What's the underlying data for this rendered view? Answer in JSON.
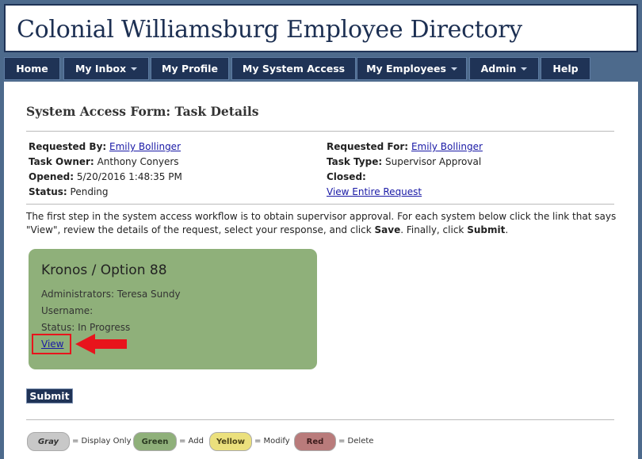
{
  "header": {
    "title": "Colonial Williamsburg Employee Directory"
  },
  "nav": [
    {
      "label": "Home",
      "has_dropdown": false
    },
    {
      "label": "My Inbox",
      "has_dropdown": true
    },
    {
      "label": "My Profile",
      "has_dropdown": false
    },
    {
      "label": "My System Access",
      "has_dropdown": false
    },
    {
      "label": "My Employees",
      "has_dropdown": true
    },
    {
      "label": "Admin",
      "has_dropdown": true
    },
    {
      "label": "Help",
      "has_dropdown": false
    }
  ],
  "form": {
    "title": "System Access Form: Task Details",
    "requested_by_label": "Requested By:",
    "requested_by_value": "Emily Bollinger",
    "task_owner_label": "Task Owner:",
    "task_owner_value": "Anthony Conyers",
    "opened_label": "Opened:",
    "opened_value": "5/20/2016 1:48:35 PM",
    "status_label": "Status:",
    "status_value": "Pending",
    "requested_for_label": "Requested For:",
    "requested_for_value": "Emily Bollinger",
    "task_type_label": "Task Type:",
    "task_type_value": "Supervisor Approval",
    "closed_label": "Closed:",
    "closed_value": "",
    "view_entire_request": "View Entire Request",
    "desc_part1": "The first step in the system access workflow is to obtain supervisor approval. For each system below click the link that says \"View\", review the details of the request, select your response, and click ",
    "desc_save": "Save",
    "desc_part2": ". Finally, click ",
    "desc_submit": "Submit",
    "desc_part3": "."
  },
  "system_card": {
    "title": "Kronos / Option 88",
    "administrators": "Administrators: Teresa Sundy",
    "username": "Username:",
    "status": "Status: In Progress",
    "view_link": "View",
    "color": "#8fb07a"
  },
  "submit_label": "Submit",
  "legend": [
    {
      "label": "Gray",
      "text": "= Display Only",
      "color": "#c8c8c8"
    },
    {
      "label": "Green",
      "text": "= Add",
      "color": "#8fb07a"
    },
    {
      "label": "Yellow",
      "text": "= Modify",
      "color": "#ebe07d"
    },
    {
      "label": "Red",
      "text": "= Delete",
      "color": "#b97b7b"
    }
  ],
  "colors": {
    "navy": "#1f3356",
    "page_bg": "#4d6a8c",
    "arrow": "#e8141c"
  }
}
